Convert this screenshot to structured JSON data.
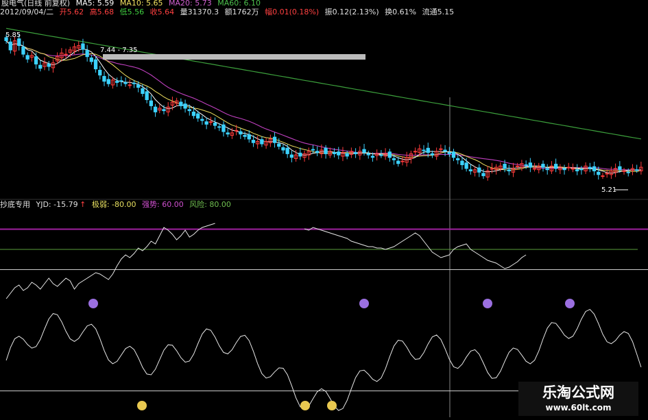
{
  "header": {
    "stock_label": "股电气(日线 前复权)",
    "ma5": "MA5: 5.59",
    "ma10": "MA10: 5.65",
    "ma20": "MA20: 5.73",
    "ma60": "MA60: 6.10",
    "date": "2012/09/04/二",
    "open": "开5.62",
    "high": "高5.68",
    "low": "低5.56",
    "close": "收5.64",
    "volume": "量31370.3",
    "amount": "额1762万",
    "change_pct": "幅0.01(0.18%)",
    "amplitude": "振0.12(2.13%)",
    "turnover": "换0.61%",
    "float": "流通5.15"
  },
  "annotations": {
    "price_high": "5.85",
    "range": "7.44 - 7.35",
    "price_low": "5.21"
  },
  "indicator": {
    "name": "抄底专用",
    "yjd": "YJD: -15.79",
    "weak": "极弱: -80.00",
    "strong": "强势: 60.00",
    "risk": "风险: 80.00"
  },
  "watermark": {
    "line1": "乐淘公式网",
    "line2": "www.60lt.com"
  },
  "colors": {
    "background": "#000000",
    "up": "#ff3b3b",
    "down": "#3cd2ff",
    "ma5": "#ffffff",
    "ma10": "#f0e060",
    "ma20": "#c040c0",
    "ma60": "#3ca03c",
    "strong_line": "#a020a0",
    "weak_line": "#5aa03c",
    "marker": "#9b6fe0",
    "smiley": "#e8c850"
  },
  "chart_data": [
    {
      "type": "candlestick",
      "title": "日线 前复权",
      "x": [
        1,
        2,
        3,
        4,
        5,
        6,
        7,
        8,
        9,
        10,
        11,
        12,
        13,
        14,
        15,
        16,
        17,
        18,
        19,
        20,
        21,
        22,
        23,
        24,
        25,
        26,
        27,
        28,
        29,
        30,
        31,
        32,
        33,
        34,
        35,
        36,
        37,
        38,
        39,
        40,
        41,
        42,
        43,
        44,
        45,
        46,
        47,
        48,
        49,
        50,
        51,
        52,
        53,
        54,
        55,
        56,
        57,
        58,
        59,
        60,
        61,
        62,
        63,
        64,
        65,
        66,
        67,
        68,
        69,
        70,
        71,
        72,
        73,
        74,
        75,
        76,
        77,
        78,
        79,
        80,
        81,
        82,
        83,
        84,
        85,
        86,
        87,
        88,
        89,
        90,
        91,
        92,
        93,
        94,
        95,
        96,
        97,
        98,
        99,
        100,
        101,
        102,
        103,
        104,
        105,
        106,
        107,
        108,
        109,
        110,
        111,
        112,
        113,
        114,
        115,
        116,
        117,
        118,
        119,
        120,
        121,
        122,
        123,
        124,
        125,
        126,
        127,
        128,
        129,
        130,
        131,
        132,
        133,
        134,
        135,
        136,
        137,
        138,
        139,
        140,
        141,
        142,
        143,
        144,
        145,
        146,
        147,
        148,
        149,
        150
      ],
      "close": [
        7.7,
        7.55,
        7.7,
        7.62,
        7.48,
        7.4,
        7.46,
        7.32,
        7.25,
        7.34,
        7.28,
        7.34,
        7.44,
        7.5,
        7.48,
        7.55,
        7.6,
        7.62,
        7.56,
        7.44,
        7.36,
        7.24,
        7.14,
        7.04,
        7.0,
        7.06,
        7.02,
        7.04,
        7.0,
        6.98,
        7.0,
        6.94,
        6.84,
        6.74,
        6.64,
        6.54,
        6.6,
        6.56,
        6.62,
        6.7,
        6.72,
        6.64,
        6.6,
        6.56,
        6.48,
        6.44,
        6.4,
        6.34,
        6.38,
        6.32,
        6.3,
        6.22,
        6.18,
        6.2,
        6.24,
        6.18,
        6.14,
        6.1,
        6.04,
        6.06,
        6.02,
        6.06,
        6.1,
        6.04,
        5.98,
        5.92,
        5.86,
        5.8,
        5.84,
        5.82,
        5.86,
        5.9,
        5.92,
        5.88,
        5.92,
        5.86,
        5.9,
        5.86,
        5.84,
        5.88,
        5.82,
        5.9,
        5.86,
        5.9,
        5.88,
        5.84,
        5.8,
        5.86,
        5.84,
        5.86,
        5.8,
        5.76,
        5.7,
        5.74,
        5.8,
        5.86,
        5.9,
        5.94,
        5.92,
        5.88,
        5.84,
        5.9,
        5.94,
        5.9,
        5.86,
        5.8,
        5.76,
        5.68,
        5.62,
        5.58,
        5.6,
        5.56,
        5.5,
        5.58,
        5.62,
        5.64,
        5.66,
        5.62,
        5.58,
        5.62,
        5.66,
        5.7,
        5.68,
        5.64,
        5.62,
        5.66,
        5.64,
        5.6,
        5.66,
        5.62,
        5.64,
        5.6,
        5.64,
        5.62,
        5.58,
        5.6,
        5.66,
        5.62,
        5.58,
        5.52,
        5.5,
        5.54,
        5.58,
        5.62,
        5.6,
        5.58,
        5.56,
        5.62,
        5.6,
        5.64
      ],
      "ma_current": {
        "MA5": 5.59,
        "MA10": 5.65,
        "MA20": 5.73,
        "MA60": 6.1
      },
      "ylim": [
        5.15,
        8.05
      ]
    },
    {
      "type": "line",
      "title": "抄底专用",
      "series": [
        {
          "name": "YJD",
          "values": [
            -28,
            -24,
            -20,
            -18,
            -22,
            -20,
            -16,
            -18,
            -21,
            -17,
            -13,
            -17,
            -19,
            -16,
            -13,
            -15,
            -21,
            -17,
            -15,
            -13,
            -11,
            -9,
            -10,
            -12,
            -14,
            -10,
            -4,
            1,
            4,
            2,
            5,
            9,
            7,
            10,
            14,
            12,
            18,
            24,
            22,
            19,
            15,
            18,
            22,
            17,
            19,
            22,
            24,
            25,
            26,
            27,
            null,
            null,
            null,
            null,
            null,
            null,
            null,
            null,
            null,
            null,
            null,
            null,
            null,
            null,
            null,
            null,
            null,
            null,
            null,
            null,
            23,
            22,
            24,
            23,
            22,
            21,
            20,
            19,
            18,
            17,
            16,
            14,
            13,
            12,
            11,
            10,
            10,
            9,
            9,
            8,
            9,
            10,
            12,
            14,
            16,
            18,
            20,
            18,
            14,
            10,
            6,
            4,
            2,
            3,
            4,
            8,
            10,
            11,
            12,
            8,
            6,
            4,
            2,
            0,
            -1,
            -2,
            -4,
            -6,
            -5,
            -3,
            -1,
            2,
            4
          ]
        },
        {
          "name": "极弱",
          "values": [
            -80
          ]
        },
        {
          "name": "强势",
          "values": [
            60
          ]
        },
        {
          "name": "风险",
          "values": [
            80
          ]
        }
      ],
      "ylim": [
        -100,
        100
      ]
    }
  ]
}
